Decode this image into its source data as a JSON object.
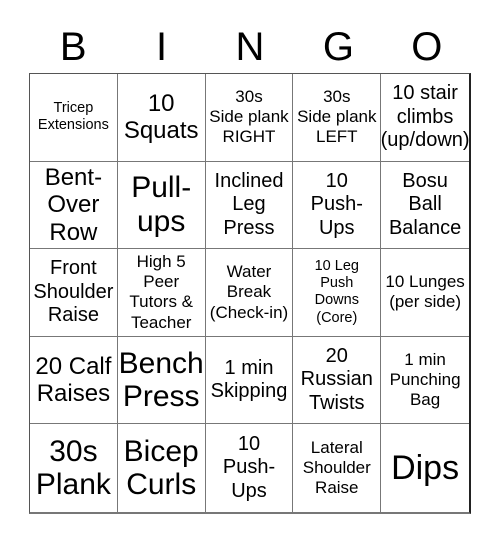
{
  "header": {
    "letters": [
      "B",
      "I",
      "N",
      "G",
      "O"
    ]
  },
  "board": {
    "cells": [
      "Tricep\nExtensions",
      "10\nSquats",
      "30s\nSide plank\nRIGHT",
      "30s\nSide plank\nLEFT",
      "10 stair\nclimbs\n(up/down)",
      "Bent-\nOver\nRow",
      "Pull-\nups",
      "Inclined\nLeg\nPress",
      "10\nPush-\nUps",
      "Bosu\nBall\nBalance",
      "Front\nShoulder\nRaise",
      "High 5\nPeer\nTutors &\nTeacher",
      "Water\nBreak\n(Check-in)",
      "10 Leg\nPush\nDowns\n(Core)",
      "10 Lunges\n(per side)",
      "20 Calf\nRaises",
      "Bench\nPress",
      "1 min\nSkipping",
      "20\nRussian\nTwists",
      "1 min\nPunching\nBag",
      "30s\nPlank",
      "Bicep\nCurls",
      "10\nPush-\nUps",
      "Lateral\nShoulder\nRaise",
      "Dips"
    ]
  }
}
